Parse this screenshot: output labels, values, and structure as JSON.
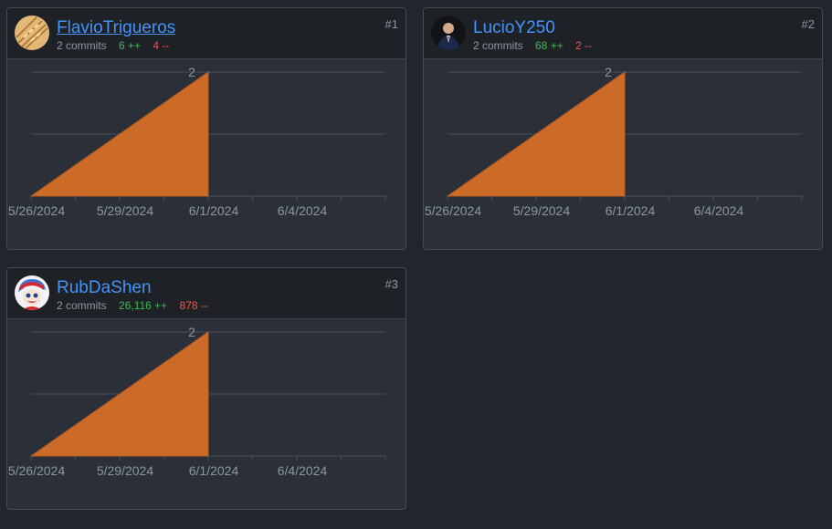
{
  "contributors": [
    {
      "username": "FlavioTrigueros",
      "commits": "2 commits",
      "additions": "6 ++",
      "deletions": "4 --",
      "rank": "#1",
      "avatar_icon": "wheat-avatar-icon",
      "chart_data": {
        "type": "area",
        "x": [
          "5/26/2024",
          "6/1/2024"
        ],
        "y": [
          0,
          2
        ],
        "xlabel": "",
        "ylabel": "",
        "ylim": [
          0,
          2
        ],
        "x_tick_labels": [
          "5/26/2024",
          "5/29/2024",
          "6/1/2024",
          "6/4/2024"
        ],
        "y_tick_labels": [
          "2"
        ],
        "grid": true,
        "color": "#cc6a28"
      }
    },
    {
      "username": "LucioY250",
      "commits": "2 commits",
      "additions": "68 ++",
      "deletions": "2 --",
      "rank": "#2",
      "avatar_icon": "person-avatar-icon",
      "chart_data": {
        "type": "area",
        "x": [
          "5/26/2024",
          "6/1/2024"
        ],
        "y": [
          0,
          2
        ],
        "xlabel": "",
        "ylabel": "",
        "ylim": [
          0,
          2
        ],
        "x_tick_labels": [
          "5/26/2024",
          "5/29/2024",
          "6/1/2024",
          "6/4/2024"
        ],
        "y_tick_labels": [
          "2"
        ],
        "grid": true,
        "color": "#cc6a28"
      }
    },
    {
      "username": "RubDaShen",
      "commits": "2 commits",
      "additions": "26,116 ++",
      "deletions": "878 --",
      "rank": "#3",
      "avatar_icon": "cartoon-avatar-icon",
      "chart_data": {
        "type": "area",
        "x": [
          "5/26/2024",
          "6/1/2024"
        ],
        "y": [
          0,
          2
        ],
        "xlabel": "",
        "ylabel": "",
        "ylim": [
          0,
          2
        ],
        "x_tick_labels": [
          "5/26/2024",
          "5/29/2024",
          "6/1/2024",
          "6/4/2024"
        ],
        "y_tick_labels": [
          "2"
        ],
        "grid": true,
        "color": "#cc6a28"
      }
    }
  ],
  "colors": {
    "accent_link": "#4493f8",
    "additions": "#3fb950",
    "deletions": "#f85149",
    "area_fill": "#cc6a28"
  }
}
